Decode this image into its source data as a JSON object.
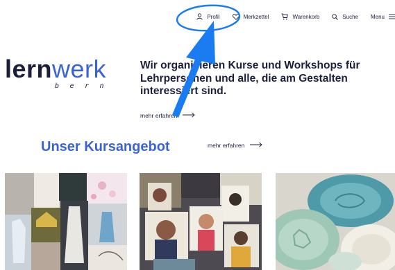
{
  "nav": {
    "items": [
      {
        "label": "Profil",
        "icon": "user-icon"
      },
      {
        "label": "Merkzettel",
        "icon": "heart-icon"
      },
      {
        "label": "Warenkorb",
        "icon": "cart-icon"
      },
      {
        "label": "Suche",
        "icon": "search-icon"
      },
      {
        "label": "Menu",
        "icon": "hamburger-icon"
      }
    ]
  },
  "logo": {
    "strong": "lern",
    "light": "werk",
    "sub": "bern"
  },
  "hero": {
    "text": "Wir organisieren Kurse und Workshops für Lehrpersonen und alle, die am Gestalten interessiert sind.",
    "link_label": "mehr erfahren",
    "link_icon": "arrow-right-icon"
  },
  "courses": {
    "title": "Unser Kursangebot",
    "link_label": "mehr erfahren",
    "link_icon": "arrow-right-icon",
    "cards": [
      {
        "image": "textile-collage-image"
      },
      {
        "image": "photo-magazines-image"
      },
      {
        "image": "ceramic-plates-image"
      }
    ]
  },
  "colors": {
    "brand_blue": "#3a63d6",
    "text_dark": "#1b1f3b",
    "annotation_blue": "#1a7cf0"
  }
}
